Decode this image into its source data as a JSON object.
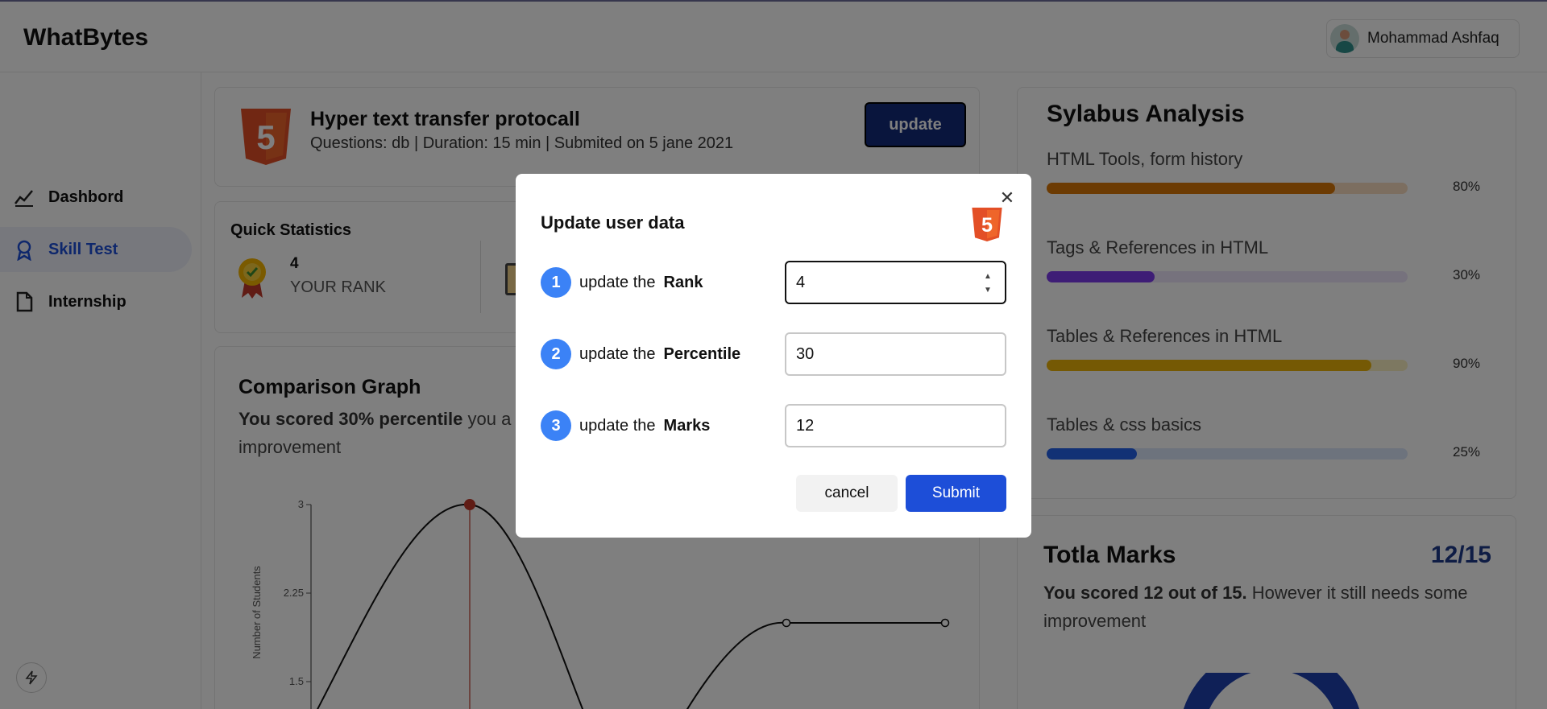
{
  "header": {
    "logo": "WhatBytes",
    "user_name": "Mohammad Ashfaq"
  },
  "sidebar": {
    "items": [
      {
        "label": "Dashbord",
        "icon": "chart-line-icon",
        "active": false
      },
      {
        "label": "Skill Test",
        "icon": "award-icon",
        "active": true
      },
      {
        "label": "Internship",
        "icon": "document-icon",
        "active": false
      }
    ]
  },
  "test": {
    "title": "Hyper text transfer protocall",
    "meta": "Questions: db | Duration: 15 min | Submited on 5 jane 2021",
    "update_label": "update"
  },
  "quick_stats": {
    "title": "Quick Statistics",
    "rank_value": "4",
    "rank_label": "YOUR RANK"
  },
  "comparison": {
    "title": "Comparison Graph",
    "bold_text": "You scored 30% percentile",
    "rest_text": " you a",
    "line2": "improvement",
    "ylabel": "Number of Students",
    "yticks": [
      "3",
      "2.25",
      "1.5"
    ]
  },
  "chart_data": {
    "type": "line",
    "ylabel": "Number of Students",
    "yticks": [
      1.5,
      2.25,
      3
    ],
    "series": [
      {
        "values": [
          3,
          2,
          2
        ]
      }
    ]
  },
  "syllabus": {
    "title": "Sylabus Analysis",
    "rows": [
      {
        "label": "HTML Tools, form history",
        "value": 80,
        "pct": "80%",
        "color": "#d97706",
        "track": "#f9dcc0"
      },
      {
        "label": "Tags & References in HTML",
        "value": 30,
        "pct": "30%",
        "color": "#7c3aed",
        "track": "#ece4fb"
      },
      {
        "label": "Tables & References in HTML",
        "value": 90,
        "pct": "90%",
        "color": "#eab308",
        "track": "#fbf1c2"
      },
      {
        "label": "Tables & css basics",
        "value": 25,
        "pct": "25%",
        "color": "#2563eb",
        "track": "#dbe6fb"
      }
    ]
  },
  "total_marks": {
    "title": "Totla Marks",
    "score": "12/15",
    "bold_text": "You scored 12 out of 15.",
    "rest_text": " However it still needs some improvement"
  },
  "modal": {
    "title": "Update user data",
    "rows": [
      {
        "num": "1",
        "text": "update the",
        "field": "Rank",
        "value": "4"
      },
      {
        "num": "2",
        "text": "update the",
        "field": "Percentile",
        "value": "30"
      },
      {
        "num": "3",
        "text": "update the",
        "field": "Marks",
        "value": "12"
      }
    ],
    "cancel_label": "cancel",
    "submit_label": "Submit"
  }
}
